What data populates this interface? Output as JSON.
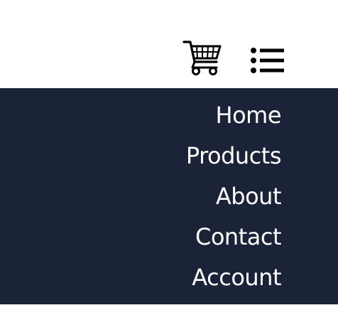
{
  "colors": {
    "panel_background": "#1a2338",
    "nav_text": "#ffffff",
    "icon": "#000000",
    "header_background": "#ffffff"
  },
  "header": {
    "cart_icon": "shopping-cart-icon",
    "menu_icon": "list-menu-icon"
  },
  "nav": {
    "items": [
      {
        "label": "Home"
      },
      {
        "label": "Products"
      },
      {
        "label": "About"
      },
      {
        "label": "Contact"
      },
      {
        "label": "Account"
      }
    ]
  }
}
